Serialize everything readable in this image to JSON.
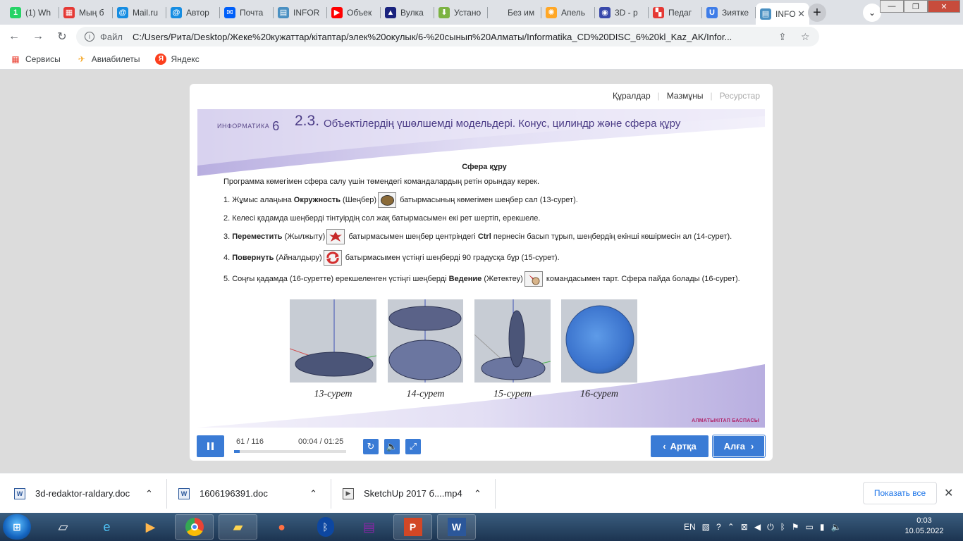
{
  "browser": {
    "tabs": [
      {
        "title": "(1) Wh",
        "icon": "whatsapp-icon",
        "color": "#25d366",
        "glyph": "1"
      },
      {
        "title": "Мың б",
        "icon": "grid-icon",
        "color": "#e53935",
        "glyph": "▦"
      },
      {
        "title": "Mail.ru",
        "icon": "mail-at-icon",
        "color": "#168de2",
        "glyph": "@"
      },
      {
        "title": "Автор",
        "icon": "mail-at-icon",
        "color": "#168de2",
        "glyph": "@"
      },
      {
        "title": "Почта",
        "icon": "envelope-icon",
        "color": "#005ff9",
        "glyph": "✉"
      },
      {
        "title": "INFOR",
        "icon": "doc-icon",
        "color": "#4a90c2",
        "glyph": "▤"
      },
      {
        "title": "Объек",
        "icon": "youtube-icon",
        "color": "#ff0000",
        "glyph": "▶"
      },
      {
        "title": "Вулка",
        "icon": "vulkan-icon",
        "color": "#1a237e",
        "glyph": "▲"
      },
      {
        "title": "Устано",
        "icon": "download-icon",
        "color": "#7cb342",
        "glyph": "⬇"
      },
      {
        "title": "Без им",
        "icon": "blank-icon",
        "color": "#dee1e6",
        "glyph": ""
      },
      {
        "title": "Апель",
        "icon": "orange-icon",
        "color": "#ffa726",
        "glyph": "✺"
      },
      {
        "title": "3D - р",
        "icon": "3d-icon",
        "color": "#3949ab",
        "glyph": "◉"
      },
      {
        "title": "Педаг",
        "icon": "flag-icon",
        "color": "#e53935",
        "glyph": "▚"
      },
      {
        "title": "Зиятке",
        "icon": "u-icon",
        "color": "#3f7de8",
        "glyph": "U"
      },
      {
        "title": "INFO",
        "icon": "doc-icon",
        "color": "#4a90c2",
        "glyph": "▤"
      }
    ],
    "address_label": "Файл",
    "url": "C:/Users/Рита/Desktop/Жеке%20кужаттар/кітаптар/элек%20окулык/6-%20сынып%20Алматы/Informatika_CD%20DISC_6%20kl_Kaz_AK/Infor...",
    "bookmarks": [
      {
        "label": "Сервисы",
        "icon": "apps-grid-icon"
      },
      {
        "label": "Авиабилеты",
        "icon": "airplane-icon"
      },
      {
        "label": "Яндекс",
        "icon": "yandex-icon"
      }
    ]
  },
  "player": {
    "topnav": {
      "tools": "Құралдар",
      "contents": "Мазмұны",
      "resources": "Ресурстар"
    },
    "brand": "ИНФОРМАТИКА",
    "grade": "6",
    "lesson_number": "2.3.",
    "lesson_title": "Объектілердің үшөлшемді модельдері. Конус, цилиндр және сфера құру",
    "section_heading": "Сфера құру",
    "intro": "Программа көмегімен сфера салу үшін төмендегі командалардың ретін орындау керек.",
    "steps": {
      "s1a": "1. Жұмыс алаңына ",
      "s1b": "Окружность",
      "s1c": " (Шеңбер)",
      "s1d": " батырмасының көмегімен шеңбер сал (13-сурет).",
      "s2": "2. Келесі қадамда шеңберді тінтуірдің сол жақ батырмасымен екі рет шертіп, ерекшеле.",
      "s3a": "3. ",
      "s3b": "Переместить",
      "s3c": " (Жылжыту)",
      "s3d": " батырмасымен шеңбер центріндегі ",
      "s3e": "Ctrl",
      "s3f": " пернесін басып тұрып, шеңбердің екінші көшірмесін ал (14-сурет).",
      "s4a": "4. ",
      "s4b": "Повернуть",
      "s4c": " (Айналдыру)",
      "s4d": " батырмасымен үстіңгі шеңберді 90 градусқа бұр (15-сурет).",
      "s5a": "5. Соңғы қадамда (16-суретте) ерекшеленген үстіңгі шеңберді ",
      "s5b": "Ведение",
      "s5c": " (Жетектеу)",
      "s5d": " командасымен тарт. Сфера пайда болады (16-сурет)."
    },
    "figures": [
      "13-сурет",
      "14-сурет",
      "15-сурет",
      "16-сурет"
    ],
    "publisher": "АЛМАТЫКІТАП БАСПАСЫ",
    "page": "61 / 116",
    "time": "00:04 / 01:25",
    "progress": 0.05,
    "back_label": "Артқа",
    "next_label": "Алға",
    "accent": "#3a7bd5"
  },
  "downloads": {
    "items": [
      "3d-redaktor-raldary.doc",
      "1606196391.doc",
      "SketchUp 2017 б....mp4"
    ],
    "show_all": "Показать все"
  },
  "taskbar": {
    "lang": "EN",
    "time": "0:03",
    "date": "10.05.2022"
  }
}
